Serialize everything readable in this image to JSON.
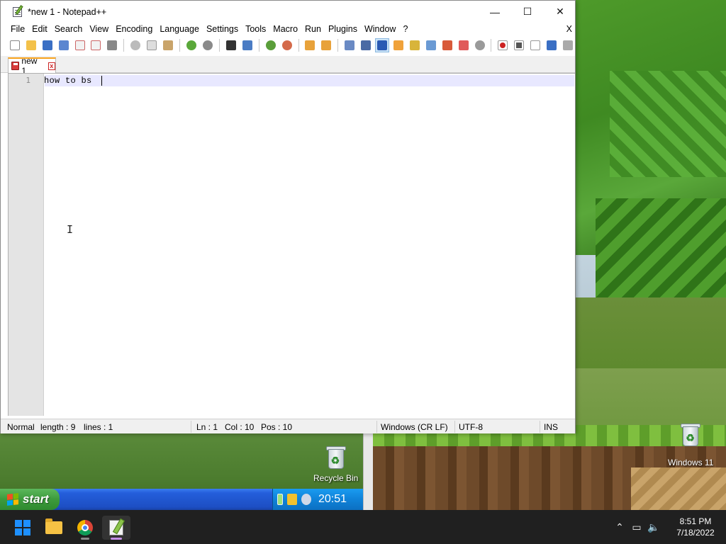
{
  "window": {
    "title": "*new 1 - Notepad++",
    "controls": {
      "minimize": "—",
      "maximize": "☐",
      "close": "✕"
    }
  },
  "menu": {
    "items": [
      "File",
      "Edit",
      "Search",
      "View",
      "Encoding",
      "Language",
      "Settings",
      "Tools",
      "Macro",
      "Run",
      "Plugins",
      "Window",
      "?"
    ],
    "close_doc": "X"
  },
  "toolbar": {
    "icons": [
      "new-file-icon",
      "open-file-icon",
      "save-icon",
      "save-all-icon",
      "close-icon",
      "close-all-icon",
      "print-icon",
      "cut-icon",
      "copy-icon",
      "paste-icon",
      "undo-icon",
      "redo-icon",
      "find-icon",
      "replace-icon",
      "zoom-in-icon",
      "zoom-out-icon",
      "sync-vertical-icon",
      "sync-horizontal-icon",
      "word-wrap-icon",
      "show-all-chars-icon",
      "indent-guide-icon",
      "user-language-icon",
      "doc-map-icon",
      "function-list-icon",
      "folder-workspace-icon",
      "monitoring-icon",
      "record-macro-icon",
      "stop-macro-icon",
      "play-macro-icon",
      "run-macro-multiple-icon",
      "save-macro-icon"
    ]
  },
  "tabs": [
    {
      "label": "new 1",
      "close": "x"
    }
  ],
  "editor": {
    "line_number": "1",
    "text": "how to bs"
  },
  "status": {
    "mode": "Normal",
    "length": "length : 9",
    "lines": "lines : 1",
    "ln": "Ln : 1",
    "col": "Col : 10",
    "pos": "Pos : 10",
    "eol": "Windows (CR LF)",
    "encoding": "UTF-8",
    "ins": "INS"
  },
  "desktop": {
    "icons": [
      {
        "label": "Recycle Bin"
      },
      {
        "label": "Windows 11"
      }
    ]
  },
  "xp_taskbar": {
    "start_label": "start",
    "clock": "20:51"
  },
  "taskbar": {
    "apps": [
      "start-icon",
      "file-explorer-icon",
      "chrome-icon",
      "notepadpp-icon"
    ],
    "tray": {
      "chevron": "^",
      "network": "▭",
      "volume": "🔊"
    },
    "time": "8:51 PM",
    "date": "7/18/2022"
  },
  "colors": {
    "tab_accent": "#f7a21b",
    "current_line": "#e8e8ff",
    "xp_taskbar": "#245edb",
    "xp_start": "#3c9a3c",
    "win11_taskbar": "#202020"
  }
}
